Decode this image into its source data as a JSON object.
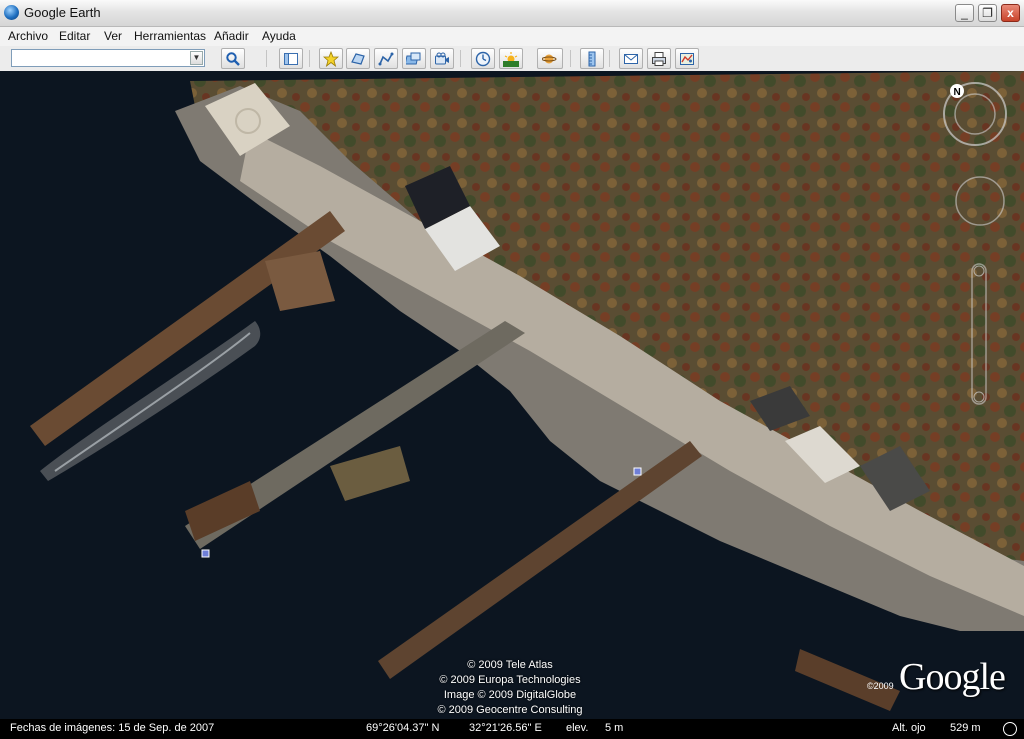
{
  "window": {
    "title": "Google Earth",
    "minimize": "_",
    "maximize": "❐",
    "close": "x"
  },
  "menu": [
    "Archivo",
    "Editar",
    "Ver",
    "Herramientas",
    "Añadir",
    "Ayuda"
  ],
  "search": {
    "value": "",
    "placeholder": ""
  },
  "toolbar_icons": [
    "search-icon",
    "sidebar-toggle-icon",
    "placemark-icon",
    "polygon-icon",
    "path-icon",
    "image-overlay-icon",
    "record-tour-icon",
    "historical-imagery-icon",
    "sunlight-icon",
    "planets-icon",
    "ruler-icon",
    "email-icon",
    "print-icon",
    "view-in-maps-icon"
  ],
  "attribution": [
    "© 2009 Tele Atlas",
    "© 2009 Europa Technologies",
    "Image © 2009 DigitalGlobe",
    "© 2009 Geocentre Consulting"
  ],
  "logo": {
    "year": "©2009",
    "text": "Google"
  },
  "status": {
    "imagery_date": "Fechas de imágenes: 15 de Sep. de 2007",
    "latitude": "69°26'04.37\" N",
    "longitude": "32°21'26.56\" E",
    "elev_label": "elev.",
    "elev_value": "5 m",
    "eye_label": "Alt. ojo",
    "eye_value": "529 m"
  },
  "compass_label": "N"
}
